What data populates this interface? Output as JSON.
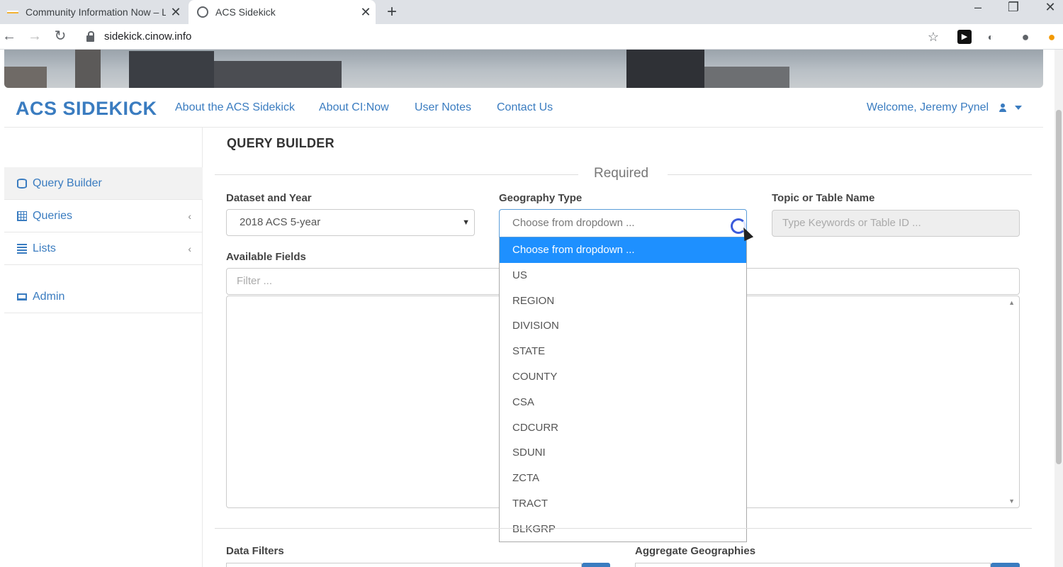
{
  "browser": {
    "tabs": [
      {
        "title": "Community Information Now – L",
        "active": false
      },
      {
        "title": "ACS Sidekick",
        "active": true
      }
    ],
    "url": "sidekick.cinow.info"
  },
  "navbar": {
    "brand": "ACS SIDEKICK",
    "links": [
      "About the ACS Sidekick",
      "About CI:Now",
      "User Notes",
      "Contact Us"
    ],
    "welcome": "Welcome, Jeremy Pynel"
  },
  "sidebar": {
    "items": [
      {
        "label": "Query Builder",
        "icon": "database-icon",
        "active": true
      },
      {
        "label": "Queries",
        "icon": "table-icon"
      },
      {
        "label": "Lists",
        "icon": "list-icon"
      },
      {
        "label": "Admin",
        "icon": "laptop-icon"
      }
    ]
  },
  "main": {
    "title": "QUERY BUILDER",
    "section_legend": "Required",
    "dataset": {
      "label": "Dataset and Year",
      "value": "2018 ACS 5-year"
    },
    "geography": {
      "label": "Geography Type",
      "value": "Choose from dropdown ...",
      "options": [
        "Choose from dropdown ...",
        "US",
        "REGION",
        "DIVISION",
        "STATE",
        "COUNTY",
        "CSA",
        "CDCURR",
        "SDUNI",
        "ZCTA",
        "TRACT",
        "BLKGRP"
      ],
      "selected_index": 0
    },
    "topic": {
      "label": "Topic or Table Name",
      "placeholder": "Type Keywords or Table ID ..."
    },
    "available_fields": {
      "label": "Available Fields",
      "filter_placeholder": "Filter ..."
    },
    "data_filters_label": "Data Filters",
    "aggregate_label": "Aggregate Geographies"
  },
  "colors": {
    "brand": "#3a7cc0",
    "selected_option": "#1e90ff"
  }
}
